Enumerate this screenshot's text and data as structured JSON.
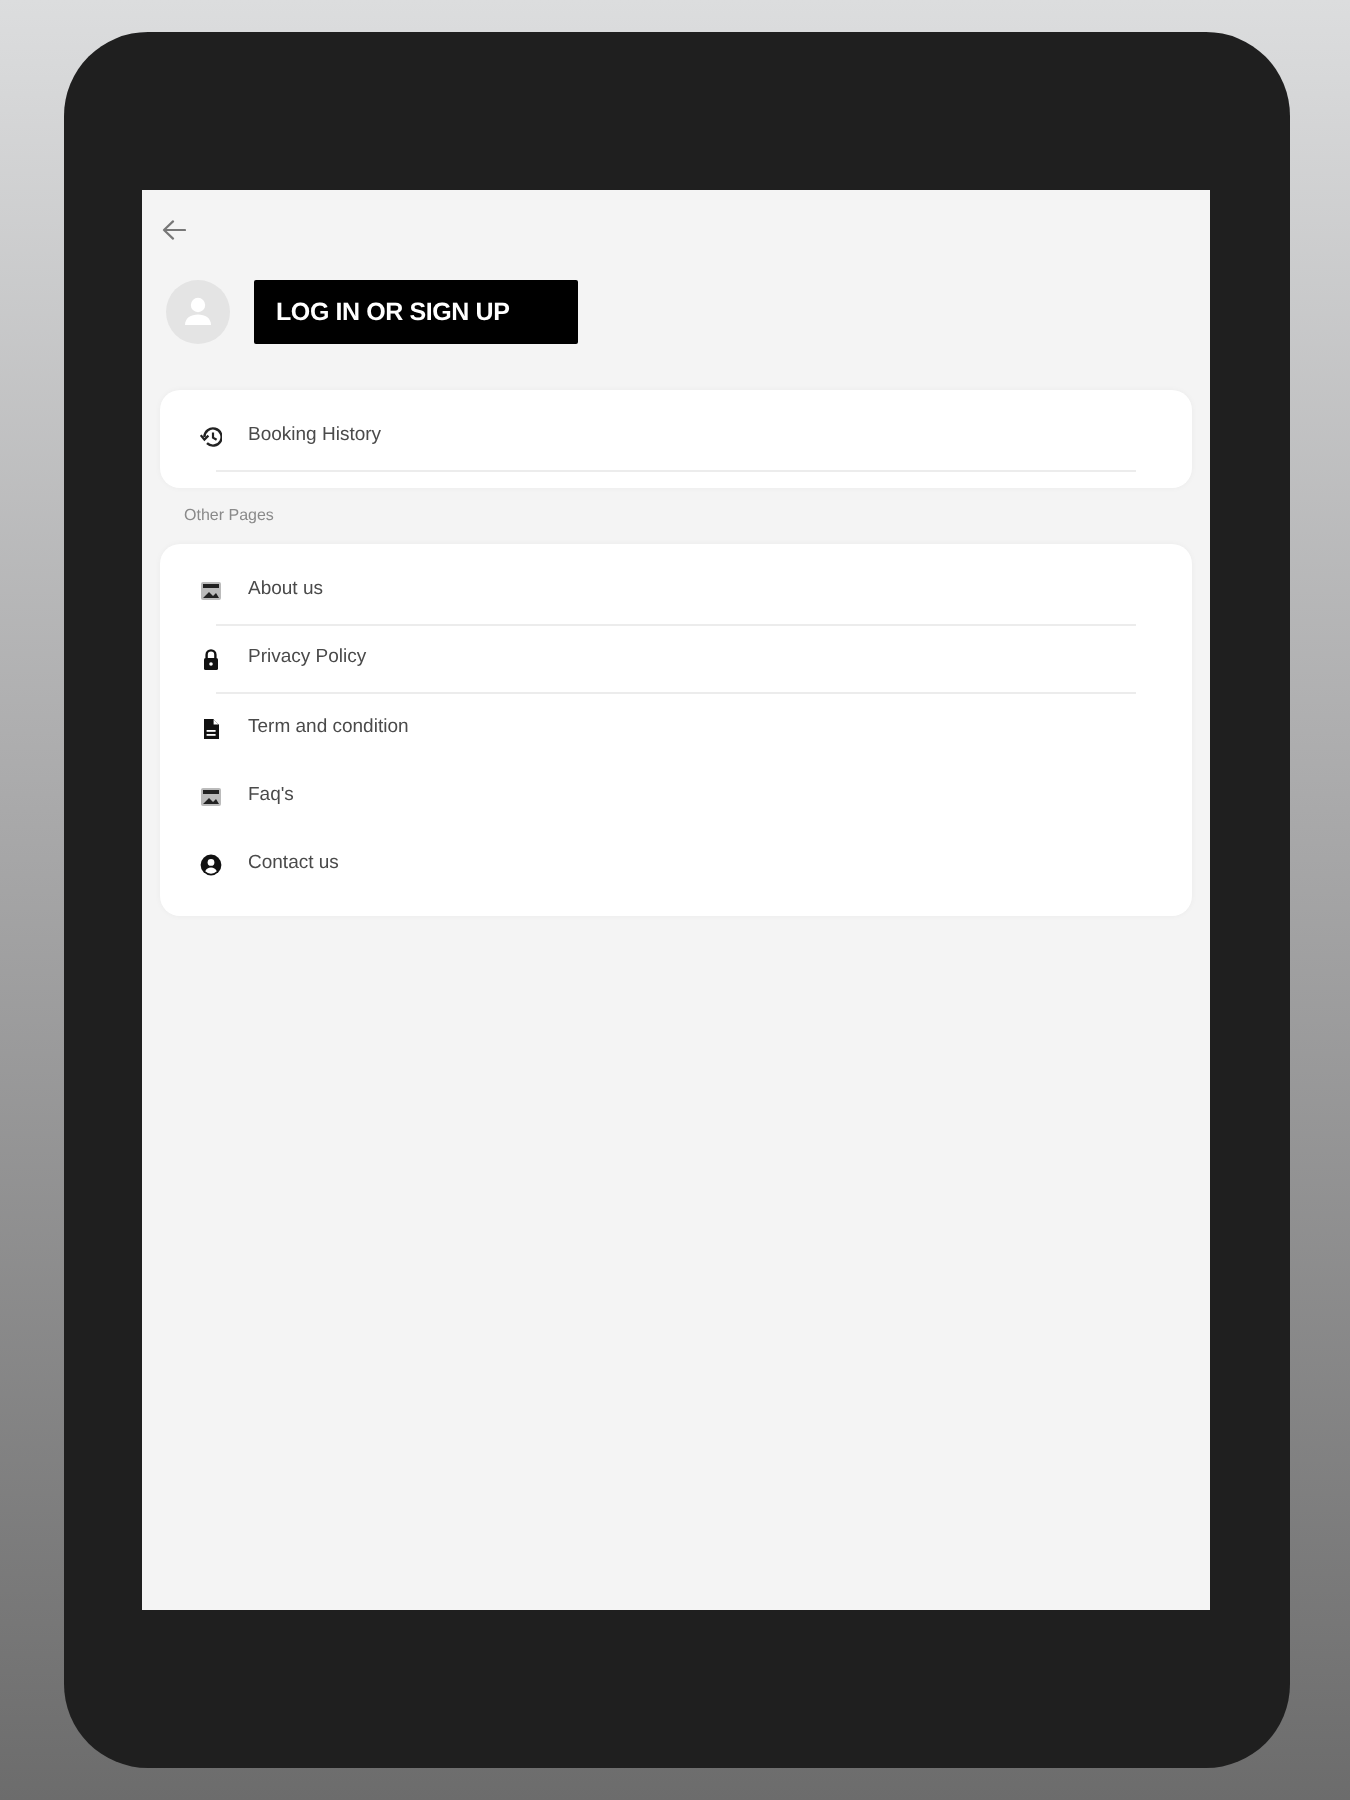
{
  "profile": {
    "login_button": "LOG IN OR SIGN UP"
  },
  "account_items": [
    {
      "label": "Booking History",
      "divider": true
    }
  ],
  "other_pages": {
    "heading": "Other Pages",
    "items": [
      {
        "label": "About us",
        "divider": true
      },
      {
        "label": "Privacy Policy",
        "divider": true
      },
      {
        "label": "Term and condition",
        "divider": false
      },
      {
        "label": "Faq's",
        "divider": false
      },
      {
        "label": "Contact us",
        "divider": false
      }
    ]
  }
}
